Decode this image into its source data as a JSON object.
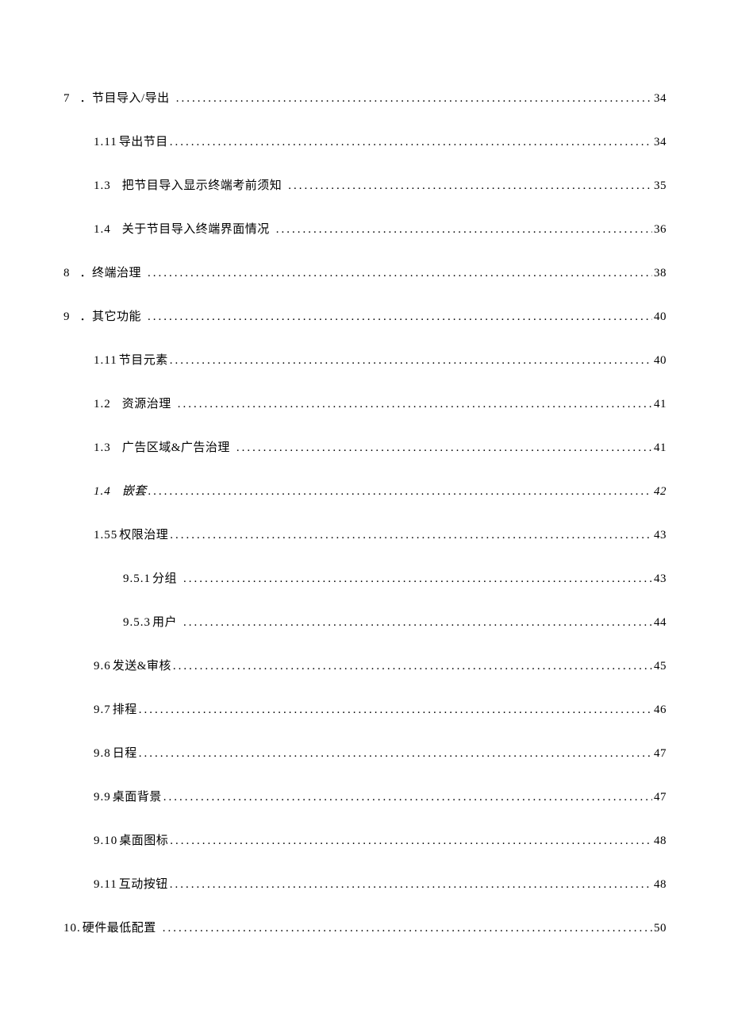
{
  "toc": [
    {
      "indent": 0,
      "num": "7",
      "sep": "．",
      "title": "节目导入/导出",
      "page": "34",
      "gap_before_sep": 12,
      "gap_after_sep": 0,
      "leader_pad": 6,
      "italic": false
    },
    {
      "indent": 1,
      "num": "1.11",
      "sep": "",
      "title": "导出节目",
      "page": "34",
      "gap_before_sep": 0,
      "gap_after_sep": 2,
      "leader_pad": 0,
      "italic": false
    },
    {
      "indent": 1,
      "num": "1.3",
      "sep": "",
      "title": "把节目导入显示终端考前须知",
      "page": "35",
      "gap_before_sep": 0,
      "gap_after_sep": 14,
      "leader_pad": 6,
      "italic": false
    },
    {
      "indent": 1,
      "num": "1.4",
      "sep": "",
      "title": "关于节目导入终端界面情况",
      "page": "36",
      "gap_before_sep": 0,
      "gap_after_sep": 14,
      "leader_pad": 6,
      "italic": false
    },
    {
      "indent": 0,
      "num": "8",
      "sep": "．",
      "title": "终端治理",
      "page": "38",
      "gap_before_sep": 12,
      "gap_after_sep": 0,
      "leader_pad": 6,
      "italic": false
    },
    {
      "indent": 0,
      "num": "9",
      "sep": "．",
      "title": "其它功能",
      "page": "40",
      "gap_before_sep": 12,
      "gap_after_sep": 0,
      "leader_pad": 6,
      "italic": false
    },
    {
      "indent": 1,
      "num": "1.11",
      "sep": "",
      "title": "节目元素",
      "page": "40",
      "gap_before_sep": 0,
      "gap_after_sep": 2,
      "leader_pad": 0,
      "italic": false
    },
    {
      "indent": 1,
      "num": "1.2",
      "sep": "",
      "title": "资源治理",
      "page": "41",
      "gap_before_sep": 0,
      "gap_after_sep": 14,
      "leader_pad": 6,
      "italic": false
    },
    {
      "indent": 1,
      "num": "1.3",
      "sep": "",
      "title": "广告区域&广告治理",
      "page": "41",
      "gap_before_sep": 0,
      "gap_after_sep": 14,
      "leader_pad": 6,
      "italic": false
    },
    {
      "indent": 1,
      "num": "1.4",
      "sep": "",
      "title": "嵌套",
      "page": "42",
      "gap_before_sep": 0,
      "gap_after_sep": 14,
      "leader_pad": 0,
      "italic": true
    },
    {
      "indent": 1,
      "num": "1.55",
      "sep": "",
      "title": "权限治理",
      "page": "43",
      "gap_before_sep": 0,
      "gap_after_sep": 2,
      "leader_pad": 0,
      "italic": false
    },
    {
      "indent": 2,
      "num": "9.5.1",
      "sep": "",
      "title": "分组",
      "page": "43",
      "gap_before_sep": 0,
      "gap_after_sep": 2,
      "leader_pad": 6,
      "italic": false
    },
    {
      "indent": 2,
      "num": "9.5.3",
      "sep": "",
      "title": "用户",
      "page": "44",
      "gap_before_sep": 0,
      "gap_after_sep": 2,
      "leader_pad": 6,
      "italic": false
    },
    {
      "indent": 1,
      "num": "9.6",
      "sep": "",
      "title": "发送&审核",
      "page": "45",
      "gap_before_sep": 0,
      "gap_after_sep": 2,
      "leader_pad": 0,
      "italic": false
    },
    {
      "indent": 1,
      "num": "9.7",
      "sep": "",
      "title": "排程",
      "page": "46",
      "gap_before_sep": 0,
      "gap_after_sep": 2,
      "leader_pad": 0,
      "italic": false
    },
    {
      "indent": 1,
      "num": "9.8",
      "sep": "",
      "title": "日程",
      "page": "47",
      "gap_before_sep": 0,
      "gap_after_sep": 2,
      "leader_pad": 0,
      "italic": false
    },
    {
      "indent": 1,
      "num": "9.9",
      "sep": "",
      "title": "桌面背景",
      "page": "47",
      "gap_before_sep": 0,
      "gap_after_sep": 2,
      "leader_pad": 0,
      "italic": false
    },
    {
      "indent": 1,
      "num": "9.10",
      "sep": "",
      "title": "桌面图标",
      "page": "48",
      "gap_before_sep": 0,
      "gap_after_sep": 2,
      "leader_pad": 0,
      "italic": false
    },
    {
      "indent": 1,
      "num": "9.11",
      "sep": "",
      "title": "互动按钮",
      "page": "48",
      "gap_before_sep": 0,
      "gap_after_sep": 2,
      "leader_pad": 0,
      "italic": false
    },
    {
      "indent": 0,
      "num": "10.",
      "sep": "",
      "title": "硬件最低配置",
      "page": "50",
      "gap_before_sep": 0,
      "gap_after_sep": 2,
      "leader_pad": 6,
      "italic": false
    }
  ]
}
